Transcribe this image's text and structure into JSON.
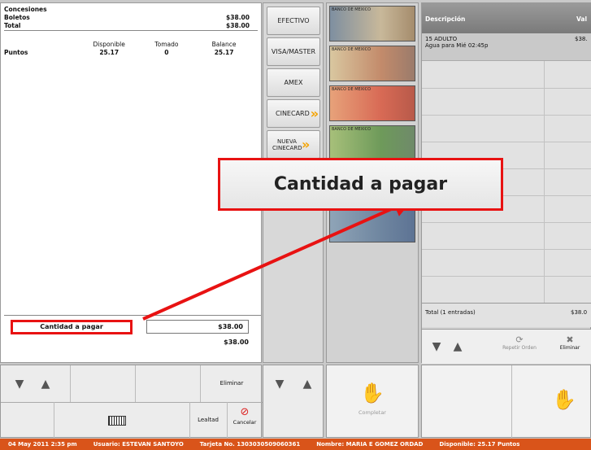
{
  "summary": {
    "concesiones_label": "Concesiones",
    "boletos_label": "Boletos",
    "boletos_value": "$38.00",
    "total_label": "Total",
    "total_value": "$38.00",
    "col_disponible": "Disponible",
    "col_tomado": "Tomado",
    "col_balance": "Balance",
    "puntos_label": "Puntos",
    "puntos_disponible": "25.17",
    "puntos_tomado": "0",
    "puntos_balance": "25.17"
  },
  "payment": {
    "cantidad_label": "Cantidad a pagar",
    "cantidad_value": "$38.00",
    "second_value": "$38.00"
  },
  "pay_methods": [
    "EFECTIVO",
    "VISA/MASTER",
    "AMEX",
    "CINECARD",
    "NUEVA CINECARD"
  ],
  "callout": {
    "text": "Cantidad a pagar",
    "color": "#e81212"
  },
  "order": {
    "col_descripcion": "Descripción",
    "col_valor": "Val",
    "item_title": "15 ADULTO",
    "item_sub": "Agua para Mié 02:45p",
    "item_value": "$38.",
    "total_label": "Total (1 entradas)",
    "total_value": "$38.0",
    "repetir_label": "Repetir Orden",
    "eliminar_label": "Eliminar"
  },
  "bottom_left": {
    "eliminar_label": "Eliminar",
    "lealtad_label": "Lealtad",
    "cancelar_label": "Cancelar"
  },
  "completar_label": "Completar",
  "status": {
    "date": "04 May 2011 2:35 pm",
    "usuario": "Usuario:  ESTEVAN  SANTOYO",
    "tarjeta": "Tarjeta No. 1303030509060361",
    "nombre": "Nombre: MARIA E GOMEZ ORDAD",
    "disponible": "Disponible: 25.17 Puntos",
    "bar_color": "#d9541a"
  },
  "banknotes": [
    "BANCO DE MEXICO",
    "BANCO DE MEXICO",
    "BANCO DE MEXICO",
    "BANCO DE MEXICO",
    "BANCO DE MEXICO"
  ]
}
